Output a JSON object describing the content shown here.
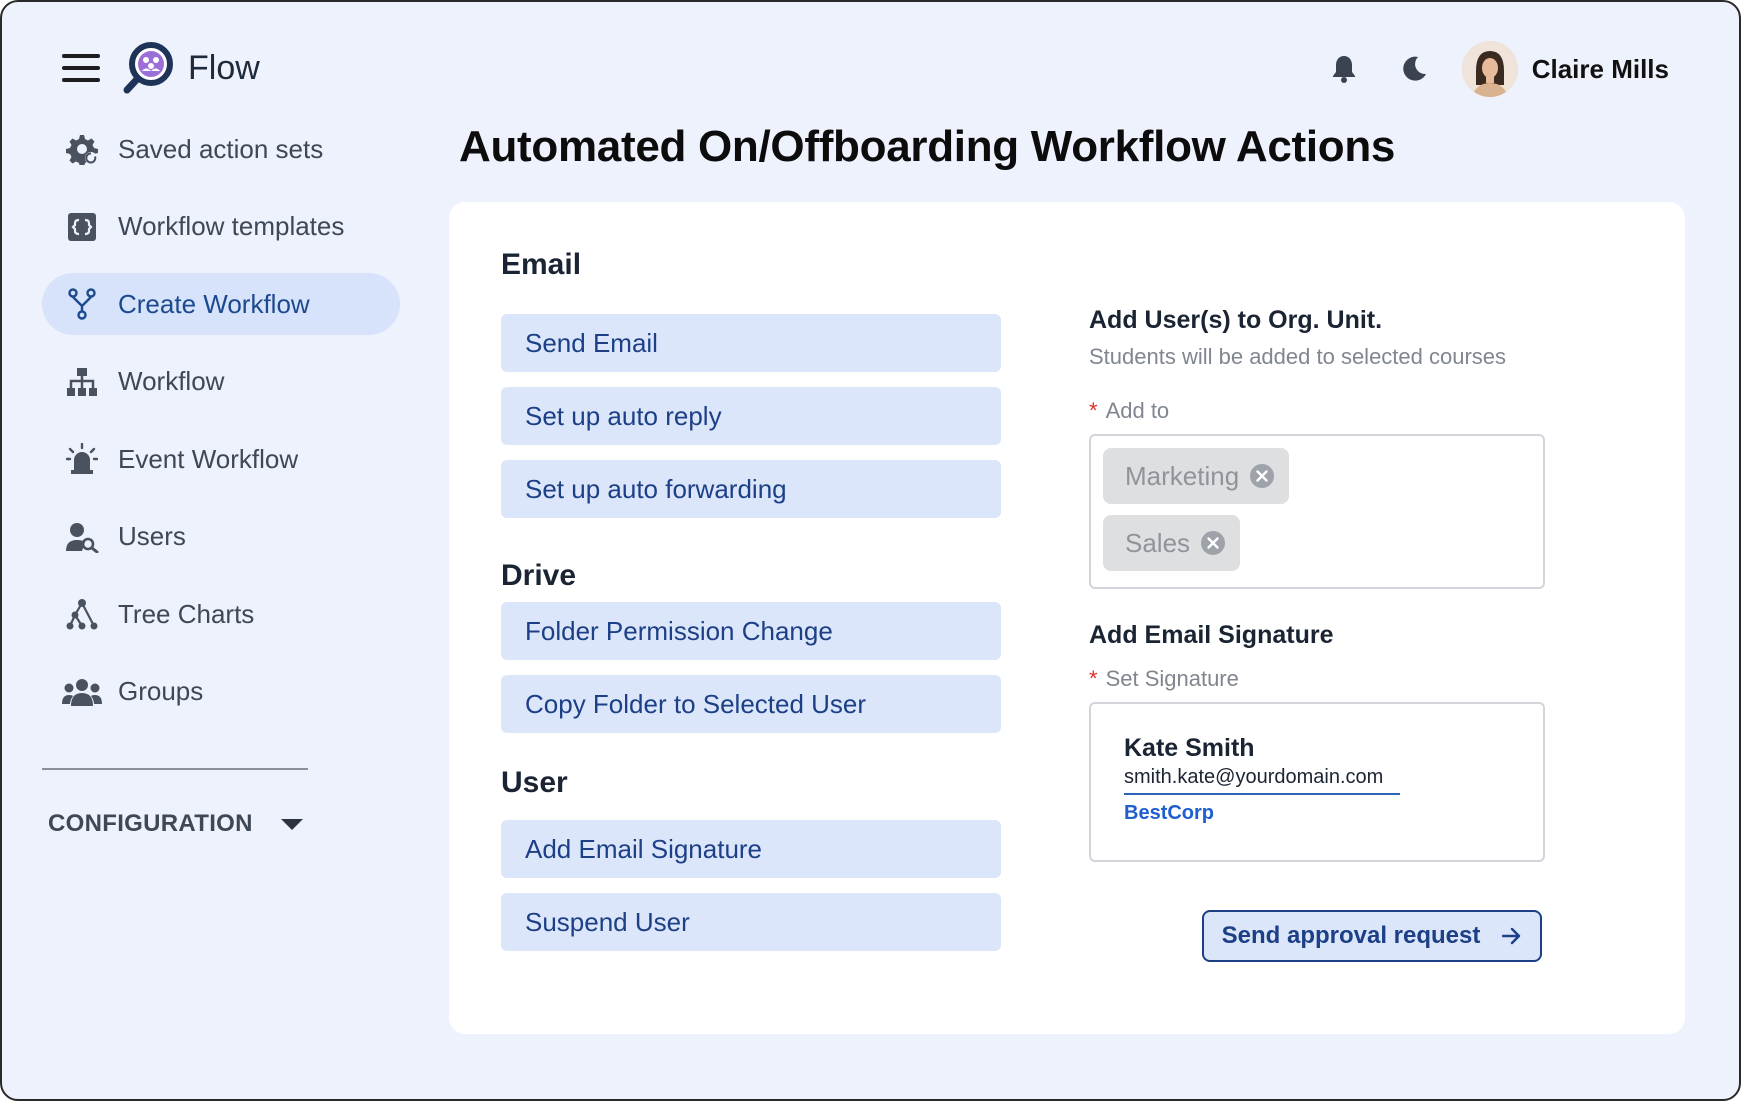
{
  "app": {
    "name": "Flow"
  },
  "user": {
    "name": "Claire Mills"
  },
  "sidebar": {
    "items": [
      {
        "label": "Saved action sets",
        "icon": "gear-settings-icon"
      },
      {
        "label": "Workflow templates",
        "icon": "template-icon"
      },
      {
        "label": "Create Workflow",
        "icon": "branch-icon",
        "active": true
      },
      {
        "label": "Workflow",
        "icon": "hierarchy-icon"
      },
      {
        "label": "Event Workflow",
        "icon": "siren-icon"
      },
      {
        "label": "Users",
        "icon": "user-search-icon"
      },
      {
        "label": "Tree Charts",
        "icon": "tree-chart-icon"
      },
      {
        "label": "Groups",
        "icon": "groups-icon"
      }
    ],
    "config_label": "CONFIGURATION"
  },
  "page": {
    "title": "Automated On/Offboarding Workflow Actions"
  },
  "sections": {
    "email": {
      "heading": "Email",
      "actions": [
        "Send Email",
        "Set up auto reply",
        "Set up auto forwarding"
      ]
    },
    "drive": {
      "heading": "Drive",
      "actions": [
        "Folder Permission Change",
        "Copy Folder to Selected User"
      ]
    },
    "user": {
      "heading": "User",
      "actions": [
        "Add Email Signature",
        "Suspend User"
      ]
    }
  },
  "org_unit": {
    "title": "Add User(s) to Org. Unit.",
    "subtitle": "Students will be added to selected courses",
    "field_label": "Add to",
    "required_mark": "*",
    "tags": [
      "Marketing",
      "Sales"
    ]
  },
  "signature": {
    "title": "Add Email Signature",
    "field_label": "Set Signature",
    "required_mark": "*",
    "name": "Kate Smith",
    "email": "smith.kate@yourdomain.com",
    "company": "BestCorp"
  },
  "approval_button": {
    "label": "Send approval request",
    "icon": "arrow-right-icon"
  },
  "colors": {
    "background": "#eef2fd",
    "accent": "#1c3f86",
    "button_fill": "#dbe6fa",
    "active_nav": "#d6e3fb",
    "required": "#e0302b",
    "link": "#1f5fd0"
  }
}
